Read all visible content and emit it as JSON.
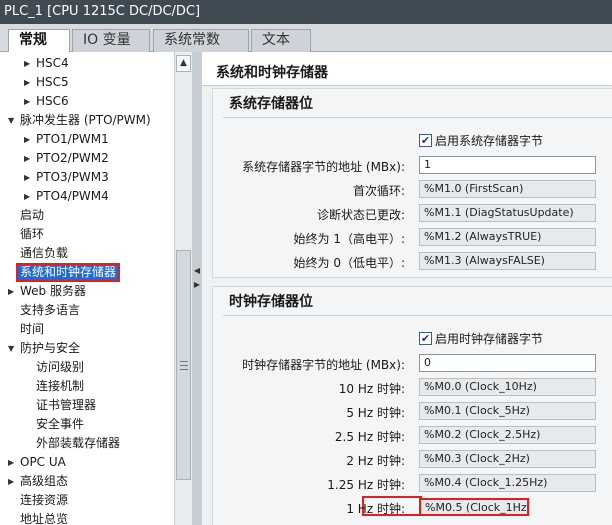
{
  "window": {
    "title": "PLC_1 [CPU 1215C DC/DC/DC]"
  },
  "tabs": [
    {
      "label": "常规"
    },
    {
      "label": "IO 变量"
    },
    {
      "label": "系统常数"
    },
    {
      "label": "文本"
    }
  ],
  "nav": {
    "items": [
      {
        "label": "HSC4",
        "tri": "▶"
      },
      {
        "label": "HSC5",
        "tri": "▶"
      },
      {
        "label": "HSC6",
        "tri": "▶"
      },
      {
        "label": "脉冲发生器 (PTO/PWM)",
        "tri": "▼"
      },
      {
        "label": "PTO1/PWM1",
        "tri": "▶"
      },
      {
        "label": "PTO2/PWM2",
        "tri": "▶"
      },
      {
        "label": "PTO3/PWM3",
        "tri": "▶"
      },
      {
        "label": "PTO4/PWM4",
        "tri": "▶"
      },
      {
        "label": "启动",
        "tri": ""
      },
      {
        "label": "循环",
        "tri": ""
      },
      {
        "label": "通信负载",
        "tri": ""
      },
      {
        "label": "系统和时钟存储器",
        "tri": ""
      },
      {
        "label": "Web 服务器",
        "tri": "▶"
      },
      {
        "label": "支持多语言",
        "tri": ""
      },
      {
        "label": "时间",
        "tri": ""
      },
      {
        "label": "防护与安全",
        "tri": "▼"
      },
      {
        "label": "访问级别",
        "tri": ""
      },
      {
        "label": "连接机制",
        "tri": ""
      },
      {
        "label": "证书管理器",
        "tri": ""
      },
      {
        "label": "安全事件",
        "tri": ""
      },
      {
        "label": "外部装载存储器",
        "tri": ""
      },
      {
        "label": "OPC UA",
        "tri": "▶"
      },
      {
        "label": "高级组态",
        "tri": "▶"
      },
      {
        "label": "连接资源",
        "tri": ""
      },
      {
        "label": "地址总览",
        "tri": ""
      }
    ]
  },
  "content": {
    "section_title": "系统和时钟存储器",
    "system": {
      "title": "系统存储器位",
      "enable_label": "启用系统存储器字节",
      "enable_checked": "✔",
      "rows": [
        {
          "label": "系统存储器字节的地址 (MBx):",
          "value": "1"
        },
        {
          "label": "首次循环:",
          "value": "%M1.0 (FirstScan)"
        },
        {
          "label": "诊断状态已更改:",
          "value": "%M1.1 (DiagStatusUpdate)"
        },
        {
          "label": "始终为 1（高电平）:",
          "value": "%M1.2 (AlwaysTRUE)"
        },
        {
          "label": "始终为 0（低电平）:",
          "value": "%M1.3 (AlwaysFALSE)"
        }
      ]
    },
    "clock": {
      "title": "时钟存储器位",
      "enable_label": "启用时钟存储器字节",
      "enable_checked": "✔",
      "rows": [
        {
          "label": "时钟存储器字节的地址 (MBx):",
          "value": "0"
        },
        {
          "label": "10 Hz 时钟:",
          "value": "%M0.0 (Clock_10Hz)"
        },
        {
          "label": "5 Hz 时钟:",
          "value": "%M0.1 (Clock_5Hz)"
        },
        {
          "label": "2.5 Hz 时钟:",
          "value": "%M0.2 (Clock_2.5Hz)"
        },
        {
          "label": "2 Hz 时钟:",
          "value": "%M0.3 (Clock_2Hz)"
        },
        {
          "label": "1.25 Hz 时钟:",
          "value": "%M0.4 (Clock_1.25Hz)"
        },
        {
          "label": "1 Hz 时钟:",
          "value": "%M0.5 (Clock_1Hz)"
        }
      ]
    }
  }
}
